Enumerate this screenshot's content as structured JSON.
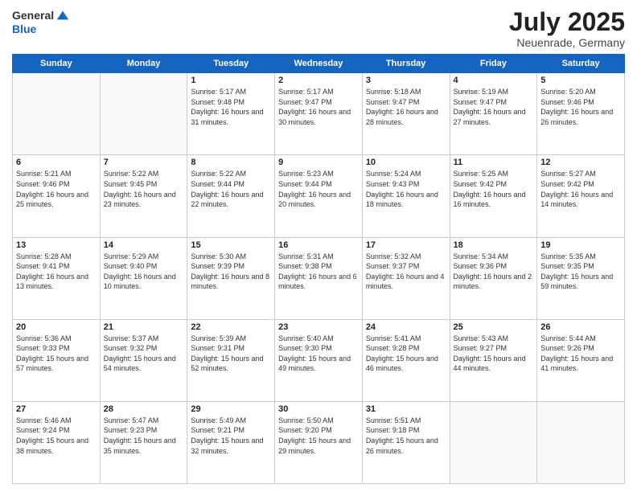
{
  "header": {
    "logo_general": "General",
    "logo_blue": "Blue",
    "title": "July 2025",
    "location": "Neuenrade, Germany"
  },
  "weekdays": [
    "Sunday",
    "Monday",
    "Tuesday",
    "Wednesday",
    "Thursday",
    "Friday",
    "Saturday"
  ],
  "weeks": [
    [
      {
        "day": "",
        "sunrise": "",
        "sunset": "",
        "daylight": ""
      },
      {
        "day": "",
        "sunrise": "",
        "sunset": "",
        "daylight": ""
      },
      {
        "day": "1",
        "sunrise": "Sunrise: 5:17 AM",
        "sunset": "Sunset: 9:48 PM",
        "daylight": "Daylight: 16 hours and 31 minutes."
      },
      {
        "day": "2",
        "sunrise": "Sunrise: 5:17 AM",
        "sunset": "Sunset: 9:47 PM",
        "daylight": "Daylight: 16 hours and 30 minutes."
      },
      {
        "day": "3",
        "sunrise": "Sunrise: 5:18 AM",
        "sunset": "Sunset: 9:47 PM",
        "daylight": "Daylight: 16 hours and 28 minutes."
      },
      {
        "day": "4",
        "sunrise": "Sunrise: 5:19 AM",
        "sunset": "Sunset: 9:47 PM",
        "daylight": "Daylight: 16 hours and 27 minutes."
      },
      {
        "day": "5",
        "sunrise": "Sunrise: 5:20 AM",
        "sunset": "Sunset: 9:46 PM",
        "daylight": "Daylight: 16 hours and 26 minutes."
      }
    ],
    [
      {
        "day": "6",
        "sunrise": "Sunrise: 5:21 AM",
        "sunset": "Sunset: 9:46 PM",
        "daylight": "Daylight: 16 hours and 25 minutes."
      },
      {
        "day": "7",
        "sunrise": "Sunrise: 5:22 AM",
        "sunset": "Sunset: 9:45 PM",
        "daylight": "Daylight: 16 hours and 23 minutes."
      },
      {
        "day": "8",
        "sunrise": "Sunrise: 5:22 AM",
        "sunset": "Sunset: 9:44 PM",
        "daylight": "Daylight: 16 hours and 22 minutes."
      },
      {
        "day": "9",
        "sunrise": "Sunrise: 5:23 AM",
        "sunset": "Sunset: 9:44 PM",
        "daylight": "Daylight: 16 hours and 20 minutes."
      },
      {
        "day": "10",
        "sunrise": "Sunrise: 5:24 AM",
        "sunset": "Sunset: 9:43 PM",
        "daylight": "Daylight: 16 hours and 18 minutes."
      },
      {
        "day": "11",
        "sunrise": "Sunrise: 5:25 AM",
        "sunset": "Sunset: 9:42 PM",
        "daylight": "Daylight: 16 hours and 16 minutes."
      },
      {
        "day": "12",
        "sunrise": "Sunrise: 5:27 AM",
        "sunset": "Sunset: 9:42 PM",
        "daylight": "Daylight: 16 hours and 14 minutes."
      }
    ],
    [
      {
        "day": "13",
        "sunrise": "Sunrise: 5:28 AM",
        "sunset": "Sunset: 9:41 PM",
        "daylight": "Daylight: 16 hours and 13 minutes."
      },
      {
        "day": "14",
        "sunrise": "Sunrise: 5:29 AM",
        "sunset": "Sunset: 9:40 PM",
        "daylight": "Daylight: 16 hours and 10 minutes."
      },
      {
        "day": "15",
        "sunrise": "Sunrise: 5:30 AM",
        "sunset": "Sunset: 9:39 PM",
        "daylight": "Daylight: 16 hours and 8 minutes."
      },
      {
        "day": "16",
        "sunrise": "Sunrise: 5:31 AM",
        "sunset": "Sunset: 9:38 PM",
        "daylight": "Daylight: 16 hours and 6 minutes."
      },
      {
        "day": "17",
        "sunrise": "Sunrise: 5:32 AM",
        "sunset": "Sunset: 9:37 PM",
        "daylight": "Daylight: 16 hours and 4 minutes."
      },
      {
        "day": "18",
        "sunrise": "Sunrise: 5:34 AM",
        "sunset": "Sunset: 9:36 PM",
        "daylight": "Daylight: 16 hours and 2 minutes."
      },
      {
        "day": "19",
        "sunrise": "Sunrise: 5:35 AM",
        "sunset": "Sunset: 9:35 PM",
        "daylight": "Daylight: 15 hours and 59 minutes."
      }
    ],
    [
      {
        "day": "20",
        "sunrise": "Sunrise: 5:36 AM",
        "sunset": "Sunset: 9:33 PM",
        "daylight": "Daylight: 15 hours and 57 minutes."
      },
      {
        "day": "21",
        "sunrise": "Sunrise: 5:37 AM",
        "sunset": "Sunset: 9:32 PM",
        "daylight": "Daylight: 15 hours and 54 minutes."
      },
      {
        "day": "22",
        "sunrise": "Sunrise: 5:39 AM",
        "sunset": "Sunset: 9:31 PM",
        "daylight": "Daylight: 15 hours and 52 minutes."
      },
      {
        "day": "23",
        "sunrise": "Sunrise: 5:40 AM",
        "sunset": "Sunset: 9:30 PM",
        "daylight": "Daylight: 15 hours and 49 minutes."
      },
      {
        "day": "24",
        "sunrise": "Sunrise: 5:41 AM",
        "sunset": "Sunset: 9:28 PM",
        "daylight": "Daylight: 15 hours and 46 minutes."
      },
      {
        "day": "25",
        "sunrise": "Sunrise: 5:43 AM",
        "sunset": "Sunset: 9:27 PM",
        "daylight": "Daylight: 15 hours and 44 minutes."
      },
      {
        "day": "26",
        "sunrise": "Sunrise: 5:44 AM",
        "sunset": "Sunset: 9:26 PM",
        "daylight": "Daylight: 15 hours and 41 minutes."
      }
    ],
    [
      {
        "day": "27",
        "sunrise": "Sunrise: 5:46 AM",
        "sunset": "Sunset: 9:24 PM",
        "daylight": "Daylight: 15 hours and 38 minutes."
      },
      {
        "day": "28",
        "sunrise": "Sunrise: 5:47 AM",
        "sunset": "Sunset: 9:23 PM",
        "daylight": "Daylight: 15 hours and 35 minutes."
      },
      {
        "day": "29",
        "sunrise": "Sunrise: 5:49 AM",
        "sunset": "Sunset: 9:21 PM",
        "daylight": "Daylight: 15 hours and 32 minutes."
      },
      {
        "day": "30",
        "sunrise": "Sunrise: 5:50 AM",
        "sunset": "Sunset: 9:20 PM",
        "daylight": "Daylight: 15 hours and 29 minutes."
      },
      {
        "day": "31",
        "sunrise": "Sunrise: 5:51 AM",
        "sunset": "Sunset: 9:18 PM",
        "daylight": "Daylight: 15 hours and 26 minutes."
      },
      {
        "day": "",
        "sunrise": "",
        "sunset": "",
        "daylight": ""
      },
      {
        "day": "",
        "sunrise": "",
        "sunset": "",
        "daylight": ""
      }
    ]
  ]
}
